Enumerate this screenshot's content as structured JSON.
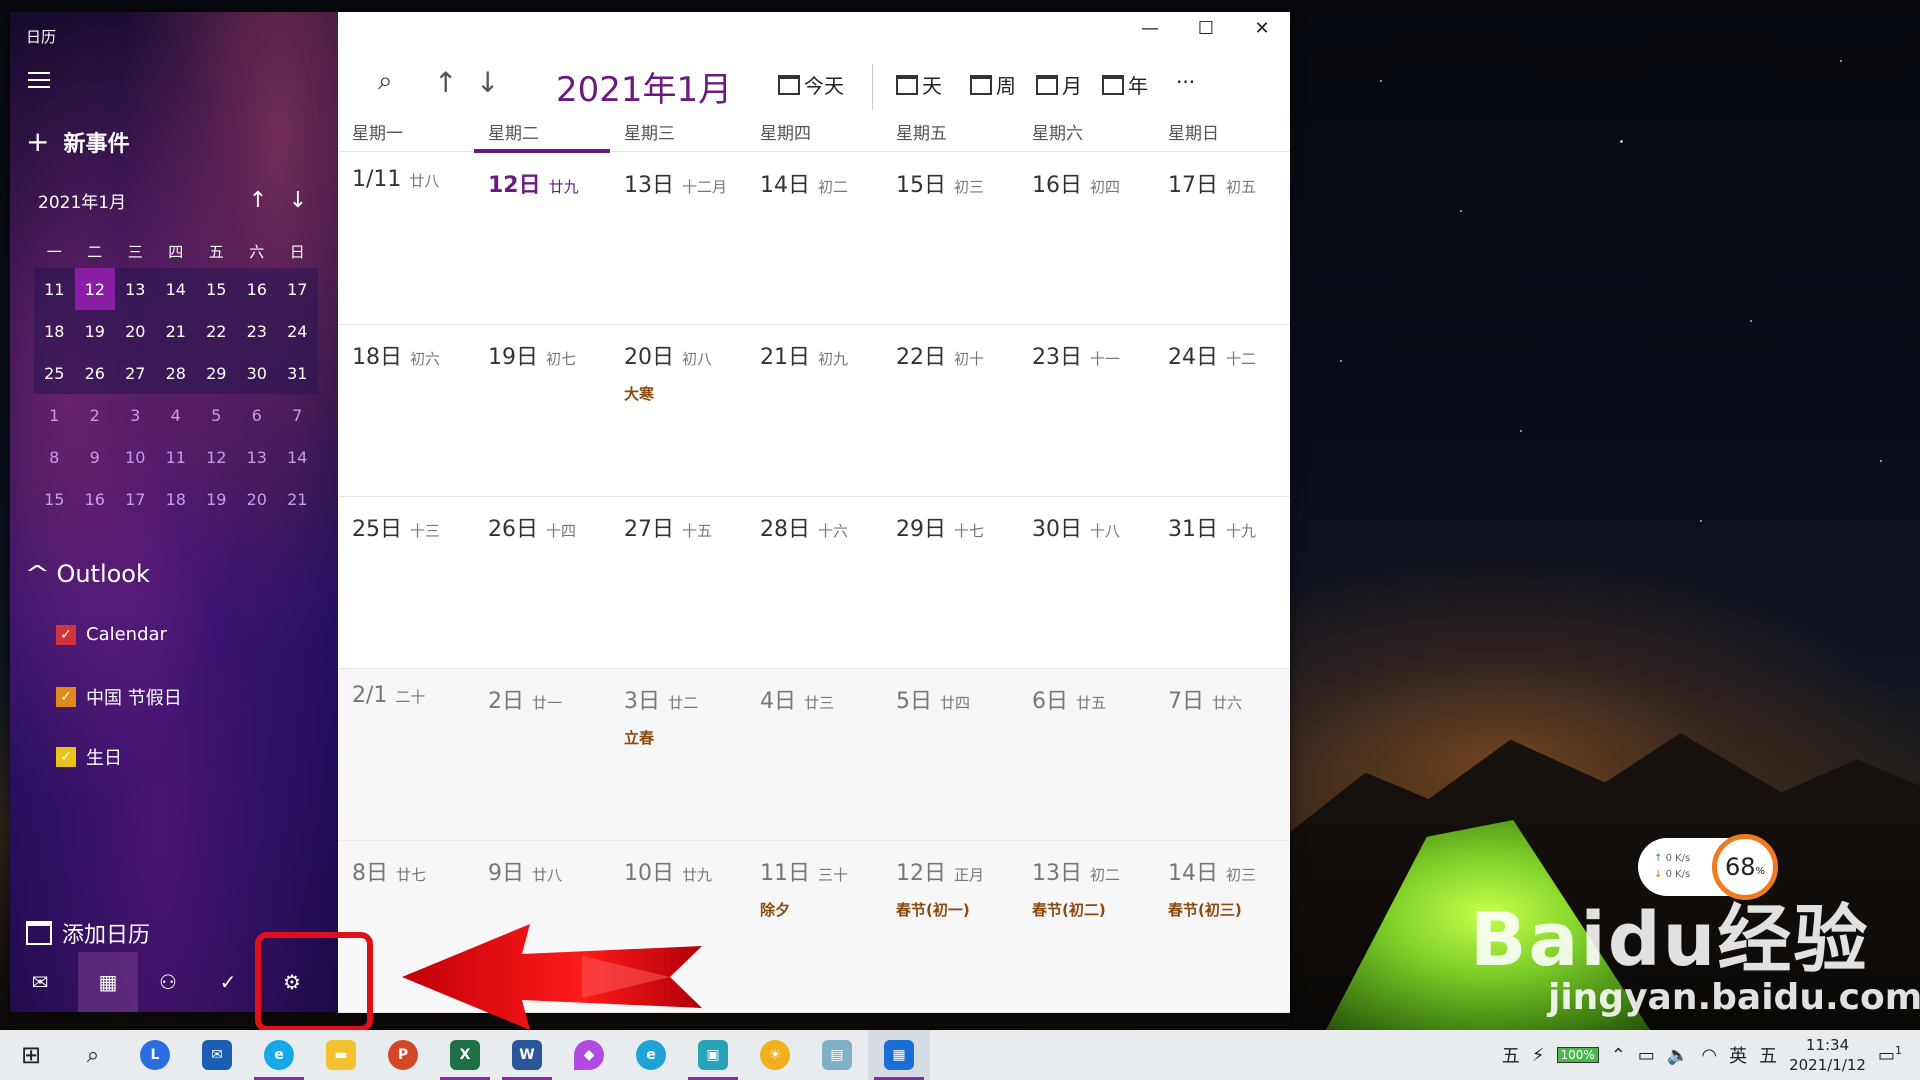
{
  "sidebar": {
    "app_title": "日历",
    "new_event": "新事件",
    "mini_month": "2021年1月",
    "mini_weekdays": [
      "一",
      "二",
      "三",
      "四",
      "五",
      "六",
      "日"
    ],
    "mini_weeks": [
      [
        "11",
        "12",
        "13",
        "14",
        "15",
        "16",
        "17"
      ],
      [
        "18",
        "19",
        "20",
        "21",
        "22",
        "23",
        "24"
      ],
      [
        "25",
        "26",
        "27",
        "28",
        "29",
        "30",
        "31"
      ],
      [
        "1",
        "2",
        "3",
        "4",
        "5",
        "6",
        "7"
      ],
      [
        "8",
        "9",
        "10",
        "11",
        "12",
        "13",
        "14"
      ],
      [
        "15",
        "16",
        "17",
        "18",
        "19",
        "20",
        "21"
      ]
    ],
    "outlook_label": "Outlook",
    "calendars": [
      {
        "name": "Calendar",
        "color": "#d13438"
      },
      {
        "name": "中国 节假日",
        "color": "#e08a1e"
      },
      {
        "name": "生日",
        "color": "#e8c31a"
      }
    ],
    "add_calendar": "添加日历"
  },
  "toolbar": {
    "month_title": "2021年1月",
    "today": "今天",
    "day": "天",
    "week": "周",
    "month": "月",
    "year": "年",
    "more": "···"
  },
  "weekdays": [
    "星期一",
    "星期二",
    "星期三",
    "星期四",
    "星期五",
    "星期六",
    "星期日"
  ],
  "weeks": [
    [
      {
        "num": "1/11",
        "lunar": "廿八"
      },
      {
        "num": "12日",
        "lunar": "廿九",
        "today": true
      },
      {
        "num": "13日",
        "lunar": "十二月"
      },
      {
        "num": "14日",
        "lunar": "初二"
      },
      {
        "num": "15日",
        "lunar": "初三"
      },
      {
        "num": "16日",
        "lunar": "初四"
      },
      {
        "num": "17日",
        "lunar": "初五"
      }
    ],
    [
      {
        "num": "18日",
        "lunar": "初六"
      },
      {
        "num": "19日",
        "lunar": "初七"
      },
      {
        "num": "20日",
        "lunar": "初八",
        "event": "大寒"
      },
      {
        "num": "21日",
        "lunar": "初九"
      },
      {
        "num": "22日",
        "lunar": "初十"
      },
      {
        "num": "23日",
        "lunar": "十一"
      },
      {
        "num": "24日",
        "lunar": "十二"
      }
    ],
    [
      {
        "num": "25日",
        "lunar": "十三"
      },
      {
        "num": "26日",
        "lunar": "十四"
      },
      {
        "num": "27日",
        "lunar": "十五"
      },
      {
        "num": "28日",
        "lunar": "十六"
      },
      {
        "num": "29日",
        "lunar": "十七"
      },
      {
        "num": "30日",
        "lunar": "十八"
      },
      {
        "num": "31日",
        "lunar": "十九"
      }
    ],
    [
      {
        "num": "2/1",
        "lunar": "二十"
      },
      {
        "num": "2日",
        "lunar": "廿一"
      },
      {
        "num": "3日",
        "lunar": "廿二",
        "event": "立春"
      },
      {
        "num": "4日",
        "lunar": "廿三"
      },
      {
        "num": "5日",
        "lunar": "廿四"
      },
      {
        "num": "6日",
        "lunar": "廿五"
      },
      {
        "num": "7日",
        "lunar": "廿六"
      }
    ],
    [
      {
        "num": "8日",
        "lunar": "廿七"
      },
      {
        "num": "9日",
        "lunar": "廿八"
      },
      {
        "num": "10日",
        "lunar": "廿九"
      },
      {
        "num": "11日",
        "lunar": "三十",
        "event": "除夕"
      },
      {
        "num": "12日",
        "lunar": "正月",
        "event": "春节(初一)"
      },
      {
        "num": "13日",
        "lunar": "初二",
        "event": "春节(初二)"
      },
      {
        "num": "14日",
        "lunar": "初三",
        "event": "春节(初三)"
      }
    ]
  ],
  "net_widget": {
    "up": "0  K/s",
    "down": "0  K/s",
    "percent": "68",
    "percent_unit": "%"
  },
  "watermark": {
    "main": "Baidu经验",
    "sub": "jingyan.baidu.com"
  },
  "taskbar": {
    "ime_mode": "五",
    "battery": "100%",
    "lang": "英",
    "ime_mode2": "五",
    "time": "11:34",
    "date": "2021/1/12",
    "notifications": "1"
  },
  "colors": {
    "accent": "#6b1a7e",
    "today_mini": "#8a1fa5",
    "annotation": "#e0101a"
  }
}
